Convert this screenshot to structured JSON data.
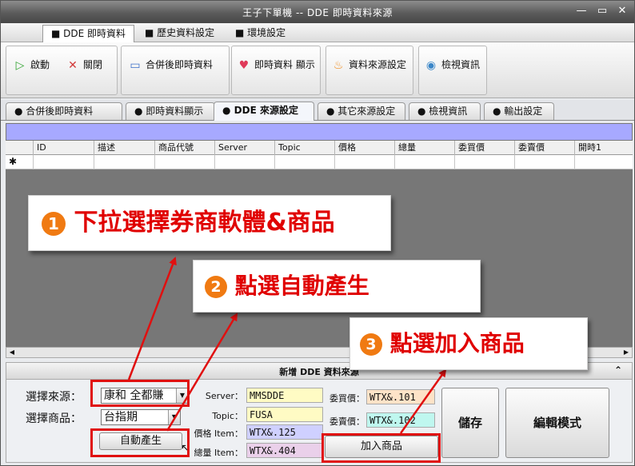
{
  "window": {
    "title": "王子下單機 -- DDE 即時資料來源",
    "controls": {
      "minimize": "—",
      "maximize": "▭",
      "close": "✕"
    }
  },
  "ribbon_tabs": [
    {
      "label": "DDE 即時資料",
      "active": true
    },
    {
      "label": "歷史資料設定",
      "active": false
    },
    {
      "label": "環境設定",
      "active": false
    }
  ],
  "ribbon_buttons": {
    "start": "啟動",
    "close": "關閉",
    "merged_realtime": "合併後即時資料",
    "realtime_display": "即時資料 顯示",
    "source_settings": "資料來源設定",
    "view_info": "檢視資訊"
  },
  "sub_tabs": [
    {
      "label": "合併後即時資料",
      "active": false
    },
    {
      "label": "即時資料顯示",
      "active": false
    },
    {
      "label": "DDE 來源設定",
      "active": true
    },
    {
      "label": "其它來源設定",
      "active": false
    },
    {
      "label": "檢視資訊",
      "active": false
    },
    {
      "label": "輸出設定",
      "active": false
    }
  ],
  "grid": {
    "columns": [
      "ID",
      "描述",
      "商品代號",
      "Server",
      "Topic",
      "價格",
      "總量",
      "委買價",
      "委賣價",
      "開時1"
    ],
    "new_row_marker": "✱"
  },
  "panel": {
    "title": "新增 DDE 資料來源",
    "source_label": "選擇來源：",
    "source_value": "康和 全都賺",
    "product_label": "選擇商品：",
    "product_value": "台指期",
    "auto_generate": "自動產生",
    "server_label": "Server：",
    "server_value": "MMSDDE",
    "topic_label": "Topic：",
    "topic_value": "FUSA",
    "price_label": "價格 Item：",
    "price_value": "WTX&.125",
    "volume_label": "總量 Item：",
    "volume_value": "WTX&.404",
    "bid_label": "委買價：",
    "bid_value": "WTX&.101",
    "ask_label": "委賣價：",
    "ask_value": "WTX&.102",
    "add_product": "加入商品",
    "save": "儲存",
    "edit_mode": "編輯模式"
  },
  "callouts": [
    {
      "num": "1",
      "text": "下拉選擇券商軟體&商品"
    },
    {
      "num": "2",
      "text": "點選自動產生"
    },
    {
      "num": "3",
      "text": "點選加入商品"
    }
  ],
  "colors": {
    "grid_header_bar": "#a7a9ff",
    "callout_text": "#e00000",
    "callout_number": "#f07a12",
    "highlight_box": "#e01010"
  }
}
